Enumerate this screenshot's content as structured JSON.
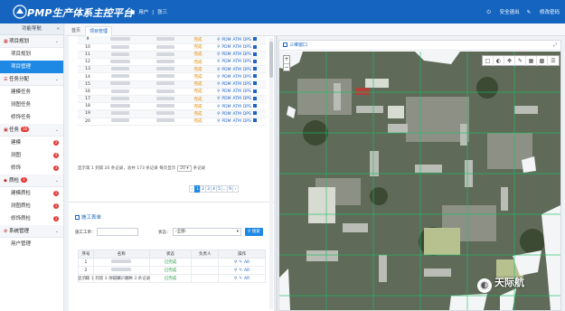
{
  "header": {
    "title": "PMP生产体系主控平台",
    "user_label": "用户",
    "user_name": "张三",
    "safe_exit": "安全退出",
    "change_password": "修改密码"
  },
  "sidebar": {
    "title": "功能导航",
    "groups": [
      {
        "label": "项目规划",
        "items": [
          "项目规划",
          "项目管理"
        ]
      },
      {
        "label": "任务分配",
        "items": [
          "建模任务",
          "测图任务",
          "修饰任务"
        ]
      },
      {
        "label": "任务",
        "badge": "16",
        "items": [
          {
            "label": "建模",
            "badge": "2"
          },
          {
            "label": "测图",
            "badge": "4"
          },
          {
            "label": "修饰",
            "badge": "3"
          }
        ]
      },
      {
        "label": "质检",
        "badge": "3",
        "items": [
          {
            "label": "建模质检",
            "badge": "1"
          },
          {
            "label": "测图质检",
            "badge": "1"
          },
          {
            "label": "修饰质检",
            "badge": "1"
          }
        ]
      },
      {
        "label": "系统管理",
        "items": [
          "用户管理"
        ]
      }
    ]
  },
  "tabs": [
    "首页",
    "项目管理"
  ],
  "project_table": {
    "rows": [
      {
        "no": "9",
        "status": "完成"
      },
      {
        "no": "10",
        "status": "完成"
      },
      {
        "no": "11",
        "status": "完成"
      },
      {
        "no": "12",
        "status": "完成"
      },
      {
        "no": "13",
        "status": "完成"
      },
      {
        "no": "14",
        "status": "完成"
      },
      {
        "no": "15",
        "status": "完成"
      },
      {
        "no": "16",
        "status": "完成"
      },
      {
        "no": "17",
        "status": "完成"
      },
      {
        "no": "18",
        "status": "完成"
      },
      {
        "no": "19",
        "status": "完成"
      },
      {
        "no": "20",
        "status": "完成"
      }
    ],
    "actions": [
      "PDM",
      "ATM",
      "DPS"
    ],
    "footer_pre": "显示第 1 到第 20 条记录，总共 173 条记录 每页显示",
    "page_size": "20",
    "footer_post": "条记录",
    "pages": [
      "‹",
      "1",
      "2",
      "3",
      "4",
      "5",
      "...",
      "9",
      "›"
    ]
  },
  "task_section": {
    "title": "施工表单",
    "filter_name_label": "施工工单：",
    "filter_status_label": "状态：",
    "filter_status_value": "-全部-",
    "search_button": "搜索",
    "columns": [
      "序号",
      "名称",
      "状态",
      "负责人",
      "操作"
    ],
    "rows": [
      {
        "no": "1",
        "status": "已完成",
        "action": "AR"
      },
      {
        "no": "2",
        "status": "已完成",
        "action": "AR"
      },
      {
        "no": "3",
        "status": "已完成",
        "action": "AR"
      }
    ],
    "footer": "显示第 1 到第 3 条记录，总共 3 条记录"
  },
  "map_panel": {
    "title": "三维窗口",
    "zoom_in": "+",
    "zoom_out": "−"
  },
  "watermark": "天际航",
  "colors": {
    "brand": "#1565c0",
    "accent": "#1e88e5",
    "badge": "#e53935",
    "status_orange": "#e08600",
    "status_green": "#2e9e49"
  }
}
